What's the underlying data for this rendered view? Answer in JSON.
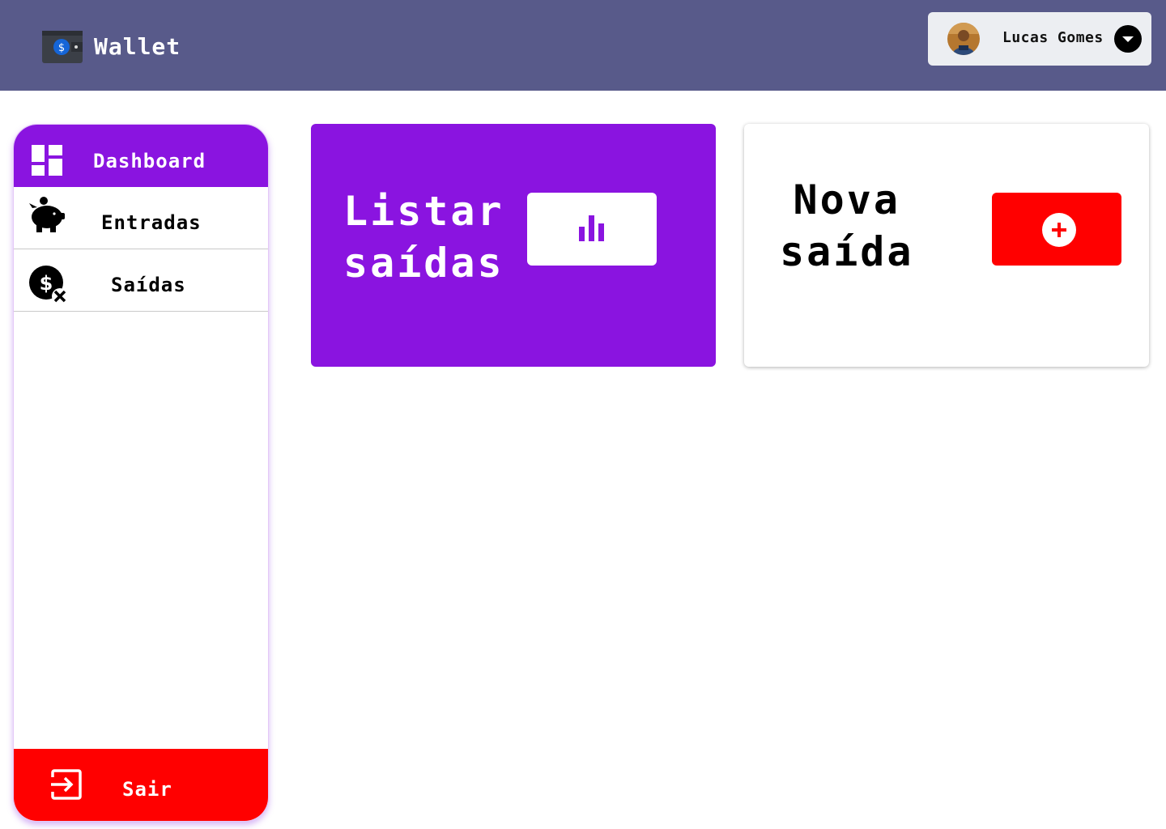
{
  "app": {
    "title": "Wallet"
  },
  "user": {
    "name": "Lucas Gomes"
  },
  "sidebar": {
    "items": [
      {
        "label": "Dashboard",
        "icon": "dashboard-icon",
        "active": true
      },
      {
        "label": "Entradas",
        "icon": "piggy-bank-icon"
      },
      {
        "label": "Saídas",
        "icon": "money-off-icon"
      }
    ],
    "logout": {
      "label": "Sair",
      "icon": "exit-icon"
    }
  },
  "cards": {
    "list_expenses": {
      "line1": "Listar",
      "line2": "saídas",
      "icon": "bar-chart-icon"
    },
    "new_expense": {
      "line1": "Nova",
      "line2": "saída",
      "icon": "plus-circle-icon"
    }
  },
  "colors": {
    "header": "#585a8a",
    "accent_purple": "#8a14e0",
    "danger_red": "#ff0000"
  }
}
